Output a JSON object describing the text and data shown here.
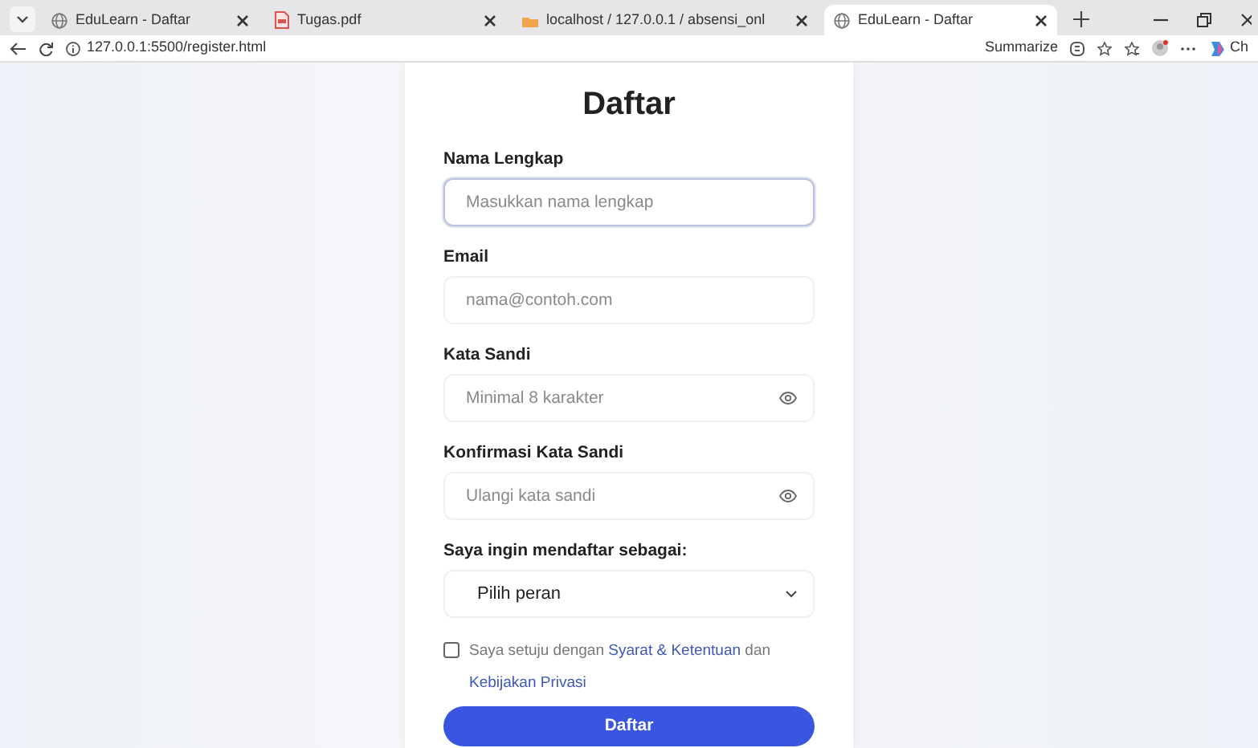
{
  "browser": {
    "tabs": [
      {
        "title": "EduLearn - Daftar",
        "selected": false
      },
      {
        "title": "Tugas.pdf",
        "selected": false
      },
      {
        "title": "localhost / 127.0.0.1 / absensi_onl",
        "selected": false
      },
      {
        "title": "EduLearn - Daftar",
        "selected": true
      }
    ],
    "address": "127.0.0.1:5500/register.html",
    "summarize": "Summarize",
    "copilot_label": "Ch"
  },
  "form": {
    "title": "Daftar",
    "fields": [
      {
        "kind": "text",
        "label": "Nama Lengkap",
        "placeholder": "Masukkan nama lengkap",
        "focused": true
      },
      {
        "kind": "email",
        "label": "Email",
        "placeholder": "nama@contoh.com",
        "focused": false
      },
      {
        "kind": "password",
        "label": "Kata Sandi",
        "placeholder": "Minimal 8 karakter",
        "focused": false
      },
      {
        "kind": "password",
        "label": "Konfirmasi Kata Sandi",
        "placeholder": "Ulangi kata sandi",
        "focused": false
      },
      {
        "kind": "select",
        "label": "Saya ingin mendaftar sebagai:",
        "value": "Pilih peran",
        "focused": false
      }
    ],
    "agree": {
      "checked": false,
      "text_before": "Saya setuju dengan",
      "link_terms": "Syarat & Ketentuan",
      "text_middle": "dan",
      "link_privacy": "Kebijakan Privasi"
    },
    "submit": "Daftar"
  }
}
